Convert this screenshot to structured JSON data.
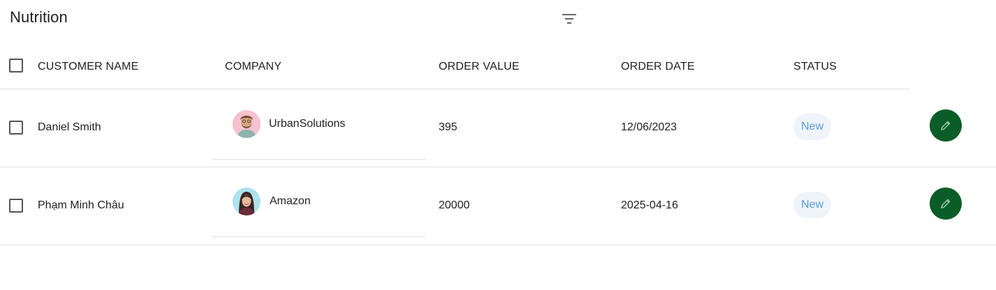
{
  "page": {
    "title": "Nutrition",
    "filter_icon": "filter-list-icon"
  },
  "columns": [
    "CUSTOMER NAME",
    "COMPANY",
    "ORDER VALUE",
    "ORDER DATE",
    "STATUS"
  ],
  "rows": [
    {
      "customer": "Daniel Smith",
      "company": "UrbanSolutions",
      "order_value": "395",
      "order_date": "12/06/2023",
      "status": "New"
    },
    {
      "customer": "Phạm Minh Châu",
      "company": "Amazon",
      "order_value": "20000",
      "order_date": "2025-04-16",
      "status": "New"
    }
  ],
  "colors": {
    "edit_button": "#0b5d28",
    "status_bg": "#eef4f9",
    "status_text": "#5b9bd5"
  },
  "icons": {
    "edit": "pencil-icon",
    "checkbox": "checkbox-icon"
  }
}
